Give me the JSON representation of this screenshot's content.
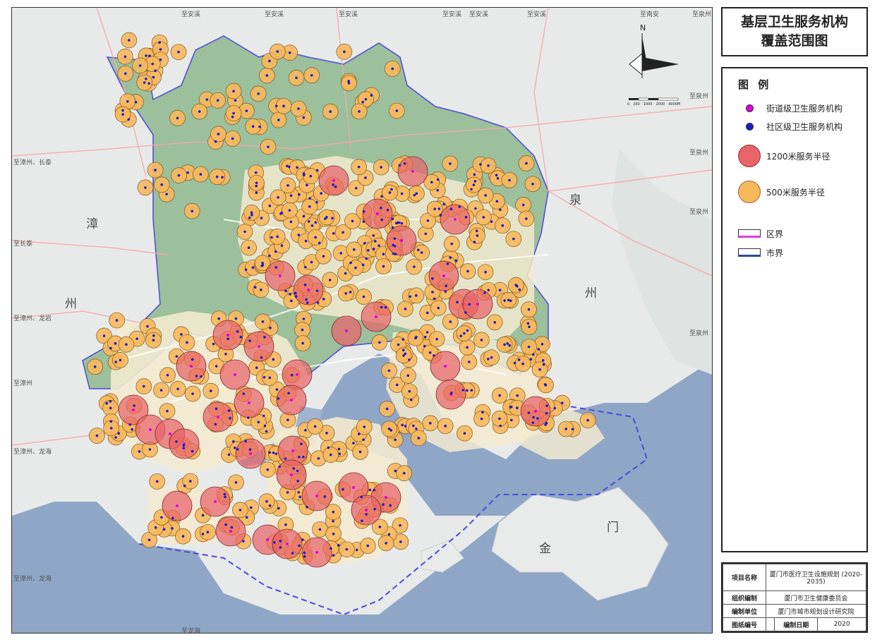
{
  "title": {
    "line1": "基层卫生服务机构",
    "line2": "覆盖范围图"
  },
  "compass": {
    "north": "N"
  },
  "scale_bar": {
    "ticks": [
      "0",
      "200",
      "1000",
      "2000",
      "4000M"
    ]
  },
  "legend": {
    "heading": "图 例",
    "items": [
      {
        "label": "街道级卫生服务机构",
        "icon": "magenta-dot",
        "color": "#e000e0"
      },
      {
        "label": "社区级卫生服务机构",
        "icon": "blue-dot",
        "color": "#1a1ad0"
      },
      {
        "label": "1200米服务半径",
        "icon": "red-circle",
        "color": "#e8646a"
      },
      {
        "label": "500米服务半径",
        "icon": "orange-circle",
        "color": "#f8b85c"
      },
      {
        "label": "区界",
        "icon": "district-boundary-line",
        "color": "#e040e0"
      },
      {
        "label": "市界",
        "icon": "city-boundary-line",
        "color": "#2a4aa0"
      }
    ]
  },
  "info_table": {
    "project_key": "项目名称",
    "project_val": "厦门市医疗卫生设施规划 (2020-2035)",
    "org_key": "组织编制",
    "org_val": "厦门市卫生健康委员会",
    "unit_key": "编制单位",
    "unit_val": "厦门市城市规划设计研究院",
    "drawing_key": "图纸编号",
    "date_key": "编制日期",
    "date_val": "2020"
  },
  "map_labels": {
    "region_names": [
      "漳",
      "州",
      "泉",
      "州",
      "金",
      "门"
    ],
    "road_labels": [
      "至安溪",
      "至安溪",
      "至安溪",
      "至安溪",
      "至安溪",
      "至安溪",
      "至南安",
      "至泉州",
      "至泉州",
      "至泉州",
      "至泉州",
      "至泉州",
      "至漳州、长泰",
      "至长泰",
      "至漳州、龙岩",
      "至漳州",
      "至漳州、龙海",
      "至漳州、龙海",
      "至龙海"
    ]
  },
  "colors": {
    "sea": "#8fa6c6",
    "land": "#e4e8e6",
    "mountain": "#9cbf9c",
    "urban": "#f3ead0",
    "red_circle": "#e8646a",
    "orange_circle": "#f8b85c"
  }
}
